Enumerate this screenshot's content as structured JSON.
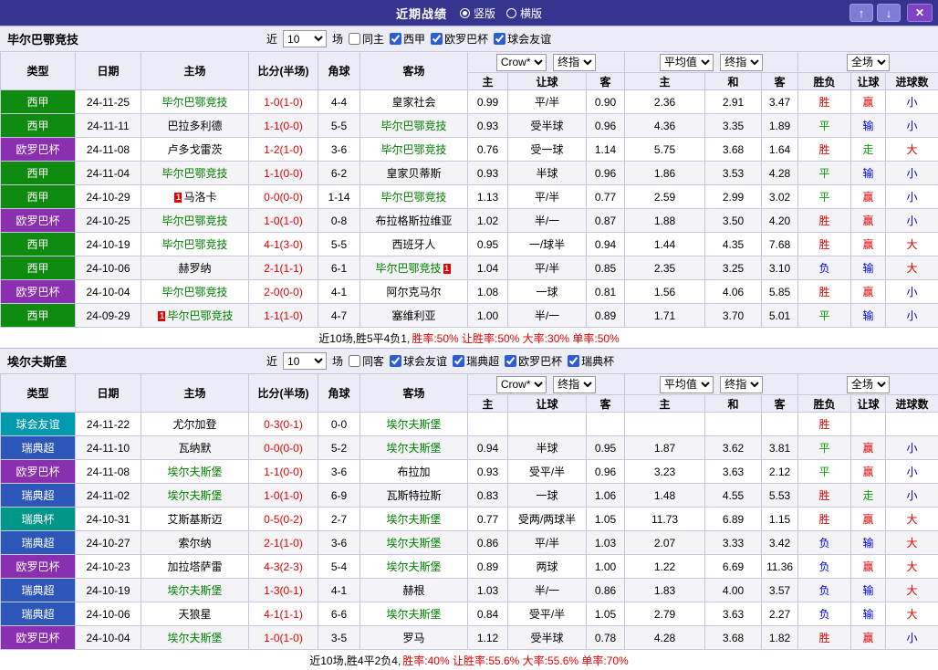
{
  "topbar": {
    "title": "近期战绩",
    "view_options": [
      {
        "label": "竖版",
        "selected": true
      },
      {
        "label": "横版",
        "selected": false
      }
    ],
    "icons": {
      "up": "↑",
      "down": "↓",
      "close": "✕"
    }
  },
  "colors": {
    "topbar": "#35358f",
    "nav_button": "#7d7dd6",
    "close_button": "#7d44c8",
    "subject_team": "#008000",
    "score": "#e60000",
    "league": {
      "西甲": "#0e8a0e",
      "欧罗巴杯": "#8a2fb0",
      "球会友谊": "#009aae",
      "瑞典超": "#2c56b8",
      "瑞典杯": "#009688"
    }
  },
  "table_header": {
    "type": "类型",
    "date": "日期",
    "home": "主场",
    "score": "比分(半场)",
    "corner": "角球",
    "away": "客场",
    "odds_source": "Crow*",
    "odds_kind": "终指",
    "avg_source": "平均值",
    "avg_kind": "终指",
    "scope": "全场",
    "sub": [
      "主",
      "让球",
      "客",
      "主",
      "和",
      "客",
      "胜负",
      "让球",
      "进球数"
    ]
  },
  "sections": [
    {
      "team": "毕尔巴鄂竞技",
      "filter": {
        "near": "近",
        "count": "10",
        "games": "场",
        "same": {
          "label": "同主",
          "checked": false
        },
        "leagues": [
          {
            "label": "西甲",
            "checked": true
          },
          {
            "label": "欧罗巴杯",
            "checked": true
          },
          {
            "label": "球会友谊",
            "checked": true
          }
        ]
      },
      "rows": [
        {
          "league": "西甲",
          "date": "24-11-25",
          "home": {
            "name": "毕尔巴鄂竞技",
            "subject": true
          },
          "score": "1-0(1-0)",
          "corner": "4-4",
          "away": {
            "name": "皇家社会"
          },
          "odds": [
            "0.99",
            "平/半",
            "0.90",
            "2.36",
            "2.91",
            "3.47"
          ],
          "results": [
            [
              "胜",
              "red"
            ],
            [
              "赢",
              "red"
            ],
            [
              "小",
              "blue"
            ]
          ]
        },
        {
          "league": "西甲",
          "date": "24-11-11",
          "home": {
            "name": "巴拉多利德"
          },
          "score": "1-1(0-0)",
          "corner": "5-5",
          "away": {
            "name": "毕尔巴鄂竞技",
            "subject": true
          },
          "odds": [
            "0.93",
            "受半球",
            "0.96",
            "4.36",
            "3.35",
            "1.89"
          ],
          "results": [
            [
              "平",
              "green"
            ],
            [
              "输",
              "blue"
            ],
            [
              "小",
              "blue"
            ]
          ]
        },
        {
          "league": "欧罗巴杯",
          "date": "24-11-08",
          "home": {
            "name": "卢多戈雷茨"
          },
          "score": "1-2(1-0)",
          "corner": "3-6",
          "away": {
            "name": "毕尔巴鄂竞技",
            "subject": true
          },
          "odds": [
            "0.76",
            "受一球",
            "1.14",
            "5.75",
            "3.68",
            "1.64"
          ],
          "results": [
            [
              "胜",
              "red"
            ],
            [
              "走",
              "green"
            ],
            [
              "大",
              "red"
            ]
          ]
        },
        {
          "league": "西甲",
          "date": "24-11-04",
          "home": {
            "name": "毕尔巴鄂竞技",
            "subject": true
          },
          "score": "1-1(0-0)",
          "corner": "6-2",
          "away": {
            "name": "皇家贝蒂斯"
          },
          "odds": [
            "0.93",
            "半球",
            "0.96",
            "1.86",
            "3.53",
            "4.28"
          ],
          "results": [
            [
              "平",
              "green"
            ],
            [
              "输",
              "blue"
            ],
            [
              "小",
              "blue"
            ]
          ]
        },
        {
          "league": "西甲",
          "date": "24-10-29",
          "home": {
            "name": "马洛卡",
            "card": "1",
            "card_pos": "before"
          },
          "score": "0-0(0-0)",
          "corner": "1-14",
          "away": {
            "name": "毕尔巴鄂竞技",
            "subject": true
          },
          "odds": [
            "1.13",
            "平/半",
            "0.77",
            "2.59",
            "2.99",
            "3.02"
          ],
          "results": [
            [
              "平",
              "green"
            ],
            [
              "赢",
              "red"
            ],
            [
              "小",
              "blue"
            ]
          ]
        },
        {
          "league": "欧罗巴杯",
          "date": "24-10-25",
          "home": {
            "name": "毕尔巴鄂竞技",
            "subject": true
          },
          "score": "1-0(1-0)",
          "corner": "0-8",
          "away": {
            "name": "布拉格斯拉维亚"
          },
          "odds": [
            "1.02",
            "半/一",
            "0.87",
            "1.88",
            "3.50",
            "4.20"
          ],
          "results": [
            [
              "胜",
              "red"
            ],
            [
              "赢",
              "red"
            ],
            [
              "小",
              "blue"
            ]
          ]
        },
        {
          "league": "西甲",
          "date": "24-10-19",
          "home": {
            "name": "毕尔巴鄂竞技",
            "subject": true
          },
          "score": "4-1(3-0)",
          "corner": "5-5",
          "away": {
            "name": "西班牙人"
          },
          "odds": [
            "0.95",
            "一/球半",
            "0.94",
            "1.44",
            "4.35",
            "7.68"
          ],
          "results": [
            [
              "胜",
              "red"
            ],
            [
              "赢",
              "red"
            ],
            [
              "大",
              "red"
            ]
          ]
        },
        {
          "league": "西甲",
          "date": "24-10-06",
          "home": {
            "name": "赫罗纳"
          },
          "score": "2-1(1-1)",
          "corner": "6-1",
          "away": {
            "name": "毕尔巴鄂竞技",
            "subject": true,
            "card": "1",
            "card_pos": "after"
          },
          "odds": [
            "1.04",
            "平/半",
            "0.85",
            "2.35",
            "3.25",
            "3.10"
          ],
          "results": [
            [
              "负",
              "blue"
            ],
            [
              "输",
              "blue"
            ],
            [
              "大",
              "red"
            ]
          ]
        },
        {
          "league": "欧罗巴杯",
          "date": "24-10-04",
          "home": {
            "name": "毕尔巴鄂竞技",
            "subject": true
          },
          "score": "2-0(0-0)",
          "corner": "4-1",
          "away": {
            "name": "阿尔克马尔"
          },
          "odds": [
            "1.08",
            "一球",
            "0.81",
            "1.56",
            "4.06",
            "5.85"
          ],
          "results": [
            [
              "胜",
              "red"
            ],
            [
              "赢",
              "red"
            ],
            [
              "小",
              "blue"
            ]
          ]
        },
        {
          "league": "西甲",
          "date": "24-09-29",
          "home": {
            "name": "毕尔巴鄂竞技",
            "subject": true,
            "card": "1",
            "card_pos": "before"
          },
          "score": "1-1(1-0)",
          "corner": "4-7",
          "away": {
            "name": "塞维利亚"
          },
          "odds": [
            "1.00",
            "半/一",
            "0.89",
            "1.71",
            "3.70",
            "5.01"
          ],
          "results": [
            [
              "平",
              "green"
            ],
            [
              "输",
              "blue"
            ],
            [
              "小",
              "blue"
            ]
          ]
        }
      ],
      "summary": {
        "record": "近10场,胜5平4负1, ",
        "stats": "胜率:50% 让胜率:50% 大率:30% 单率:50%"
      }
    },
    {
      "team": "埃尔夫斯堡",
      "filter": {
        "near": "近",
        "count": "10",
        "games": "场",
        "same": {
          "label": "同客",
          "checked": false
        },
        "leagues": [
          {
            "label": "球会友谊",
            "checked": true
          },
          {
            "label": "瑞典超",
            "checked": true
          },
          {
            "label": "欧罗巴杯",
            "checked": true
          },
          {
            "label": "瑞典杯",
            "checked": true
          }
        ]
      },
      "rows": [
        {
          "league": "球会友谊",
          "date": "24-11-22",
          "home": {
            "name": "尤尔加登"
          },
          "score": "0-3(0-1)",
          "corner": "0-0",
          "away": {
            "name": "埃尔夫斯堡",
            "subject": true
          },
          "odds": [
            "",
            "",
            "",
            "",
            "",
            ""
          ],
          "results": [
            [
              "胜",
              "red"
            ],
            [
              "",
              ""
            ],
            [
              "",
              ""
            ]
          ]
        },
        {
          "league": "瑞典超",
          "date": "24-11-10",
          "home": {
            "name": "瓦纳默"
          },
          "score": "0-0(0-0)",
          "corner": "5-2",
          "away": {
            "name": "埃尔夫斯堡",
            "subject": true
          },
          "odds": [
            "0.94",
            "半球",
            "0.95",
            "1.87",
            "3.62",
            "3.81"
          ],
          "results": [
            [
              "平",
              "green"
            ],
            [
              "赢",
              "red"
            ],
            [
              "小",
              "blue"
            ]
          ]
        },
        {
          "league": "欧罗巴杯",
          "date": "24-11-08",
          "home": {
            "name": "埃尔夫斯堡",
            "subject": true
          },
          "score": "1-1(0-0)",
          "corner": "3-6",
          "away": {
            "name": "布拉加"
          },
          "odds": [
            "0.93",
            "受平/半",
            "0.96",
            "3.23",
            "3.63",
            "2.12"
          ],
          "results": [
            [
              "平",
              "green"
            ],
            [
              "赢",
              "red"
            ],
            [
              "小",
              "blue"
            ]
          ]
        },
        {
          "league": "瑞典超",
          "date": "24-11-02",
          "home": {
            "name": "埃尔夫斯堡",
            "subject": true
          },
          "score": "1-0(1-0)",
          "corner": "6-9",
          "away": {
            "name": "瓦斯特拉斯"
          },
          "odds": [
            "0.83",
            "一球",
            "1.06",
            "1.48",
            "4.55",
            "5.53"
          ],
          "results": [
            [
              "胜",
              "red"
            ],
            [
              "走",
              "green"
            ],
            [
              "小",
              "blue"
            ]
          ]
        },
        {
          "league": "瑞典杯",
          "date": "24-10-31",
          "home": {
            "name": "艾斯基斯迈"
          },
          "score": "0-5(0-2)",
          "corner": "2-7",
          "away": {
            "name": "埃尔夫斯堡",
            "subject": true
          },
          "odds": [
            "0.77",
            "受两/两球半",
            "1.05",
            "11.73",
            "6.89",
            "1.15"
          ],
          "results": [
            [
              "胜",
              "red"
            ],
            [
              "赢",
              "red"
            ],
            [
              "大",
              "red"
            ]
          ]
        },
        {
          "league": "瑞典超",
          "date": "24-10-27",
          "home": {
            "name": "索尔纳"
          },
          "score": "2-1(1-0)",
          "corner": "3-6",
          "away": {
            "name": "埃尔夫斯堡",
            "subject": true
          },
          "odds": [
            "0.86",
            "平/半",
            "1.03",
            "2.07",
            "3.33",
            "3.42"
          ],
          "results": [
            [
              "负",
              "blue"
            ],
            [
              "输",
              "blue"
            ],
            [
              "大",
              "red"
            ]
          ]
        },
        {
          "league": "欧罗巴杯",
          "date": "24-10-23",
          "home": {
            "name": "加拉塔萨雷"
          },
          "score": "4-3(2-3)",
          "corner": "5-4",
          "away": {
            "name": "埃尔夫斯堡",
            "subject": true
          },
          "odds": [
            "0.89",
            "两球",
            "1.00",
            "1.22",
            "6.69",
            "11.36"
          ],
          "results": [
            [
              "负",
              "blue"
            ],
            [
              "赢",
              "red"
            ],
            [
              "大",
              "red"
            ]
          ]
        },
        {
          "league": "瑞典超",
          "date": "24-10-19",
          "home": {
            "name": "埃尔夫斯堡",
            "subject": true
          },
          "score": "1-3(0-1)",
          "corner": "4-1",
          "away": {
            "name": "赫根"
          },
          "odds": [
            "1.03",
            "半/一",
            "0.86",
            "1.83",
            "4.00",
            "3.57"
          ],
          "results": [
            [
              "负",
              "blue"
            ],
            [
              "输",
              "blue"
            ],
            [
              "大",
              "red"
            ]
          ]
        },
        {
          "league": "瑞典超",
          "date": "24-10-06",
          "home": {
            "name": "天狼星"
          },
          "score": "4-1(1-1)",
          "corner": "6-6",
          "away": {
            "name": "埃尔夫斯堡",
            "subject": true
          },
          "odds": [
            "0.84",
            "受平/半",
            "1.05",
            "2.79",
            "3.63",
            "2.27"
          ],
          "results": [
            [
              "负",
              "blue"
            ],
            [
              "输",
              "blue"
            ],
            [
              "大",
              "red"
            ]
          ]
        },
        {
          "league": "欧罗巴杯",
          "date": "24-10-04",
          "home": {
            "name": "埃尔夫斯堡",
            "subject": true
          },
          "score": "1-0(1-0)",
          "corner": "3-5",
          "away": {
            "name": "罗马"
          },
          "odds": [
            "1.12",
            "受半球",
            "0.78",
            "4.28",
            "3.68",
            "1.82"
          ],
          "results": [
            [
              "胜",
              "red"
            ],
            [
              "赢",
              "red"
            ],
            [
              "小",
              "blue"
            ]
          ]
        }
      ],
      "summary": {
        "record": "近10场,胜4平2负4, ",
        "stats": "胜率:40% 让胜率:55.6% 大率:55.6% 单率:70%"
      }
    }
  ]
}
